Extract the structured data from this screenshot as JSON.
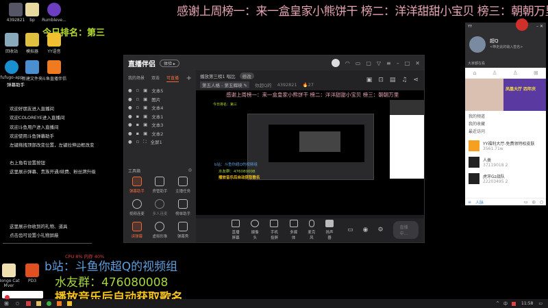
{
  "overlay": {
    "banner": "感谢上周榜一：来一盒皇家小熊饼干 榜二：洋洋甜甜小宝贝 榜三：朝朝万里",
    "rank": "今日排名：第三",
    "bili": "b站：斗鱼你超Q的视频组",
    "group": "水友群：476080008",
    "music": "播放音乐后自动获取歌名",
    "stats": "CPU 8% 内存 40%"
  },
  "desktop": {
    "icons": [
      "4392821",
      "bp",
      "Rumbleve...",
      "回收站",
      "模拟器",
      "YY语音",
      "fufugo-app",
      "新建文件夹",
      "斗鱼直播伴侣",
      "Bongo Cat Mver",
      "PD3"
    ]
  },
  "chat": [
    "弹幕助手",
    "欢迎好朋友进入直播间",
    "欢迎COLOREYE进入直播间",
    "欢迎斗鱼用户进入直播间",
    "欢迎使用斗鱼弹幕助手",
    "左键拖拽顶部改变位置，左键拉伸边框改变",
    "右上角有设置按钮",
    "这里展示弹幕、贵族开通/续费、粉丝牌升级",
    "这里展示你收到的礼物、道具",
    "点击齿可设置小礼物屏蔽"
  ],
  "app": {
    "title": "直播伴侣",
    "pill": "体验 ▸",
    "tabs": [
      "我的场景",
      "双击",
      "可直播"
    ],
    "add": "+",
    "layers": [
      "文本5",
      "图片",
      "文本4",
      "文本1",
      "文本3",
      "文本2",
      "全屏1"
    ],
    "room_title": "播放第三榜1 唱比",
    "edit": "修改",
    "category": "第五人格 - 第五辉映 ✎",
    "owner": "你超Q的",
    "room_id": "4392821",
    "heat": "🔥27",
    "toolbox": "工具箱",
    "tools": [
      "弹幕助手",
      "房管助手",
      "主播任务",
      "视频连麦",
      "多人连麦",
      "榜单助手",
      "读弹幕",
      "虚拟形象",
      "弹幕秀",
      "",
      "",
      ""
    ],
    "bar": [
      "直播屏幕",
      "摄像头",
      "手机投屏",
      "多媒体",
      "麦克风",
      "扬声器"
    ],
    "live": "直播中..."
  },
  "yy": {
    "title": "YY",
    "name": "超Q",
    "sign": "<带走此的输入签名>",
    "notice": "大家都在看",
    "menu": [
      "我的频道",
      "我的收藏",
      "最近访问"
    ],
    "recent": [
      {
        "name": "YY福利大厅-免费领特权皮肤",
        "id": "3561.71w"
      },
      {
        "name": "人类",
        "id": "37119018",
        "n": "2"
      },
      {
        "name": "虎牙Gz战队",
        "id": "22203495",
        "n": "2"
      }
    ],
    "bottom": "人脉",
    "banner2": "凤凰大厅 四年庆"
  },
  "taskbar": {
    "time": "11:58",
    "ime": "中"
  }
}
